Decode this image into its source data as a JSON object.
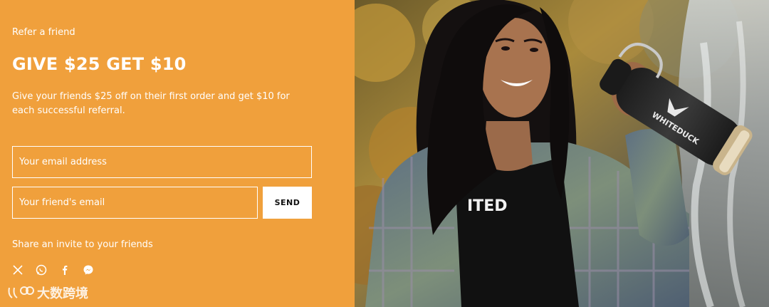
{
  "referral": {
    "kicker": "Refer a friend",
    "title": "GIVE $25 GET $10",
    "description": "Give your friends $25 off on their first order and get $10 for each successful referral.",
    "email_placeholder": "Your email address",
    "friend_email_placeholder": "Your friend's email",
    "send_label": "SEND",
    "share_text": "Share an invite to your friends",
    "share_icons": [
      "x-icon",
      "whatsapp-icon",
      "facebook-icon",
      "messenger-icon"
    ]
  },
  "watermark": {
    "text": "大数跨境"
  },
  "photo": {
    "bottle_brand": "WHITEDUCK",
    "shirt_text": "ITED"
  },
  "colors": {
    "accent": "#f0a03c",
    "text": "#ffffff",
    "button_bg": "#ffffff"
  }
}
